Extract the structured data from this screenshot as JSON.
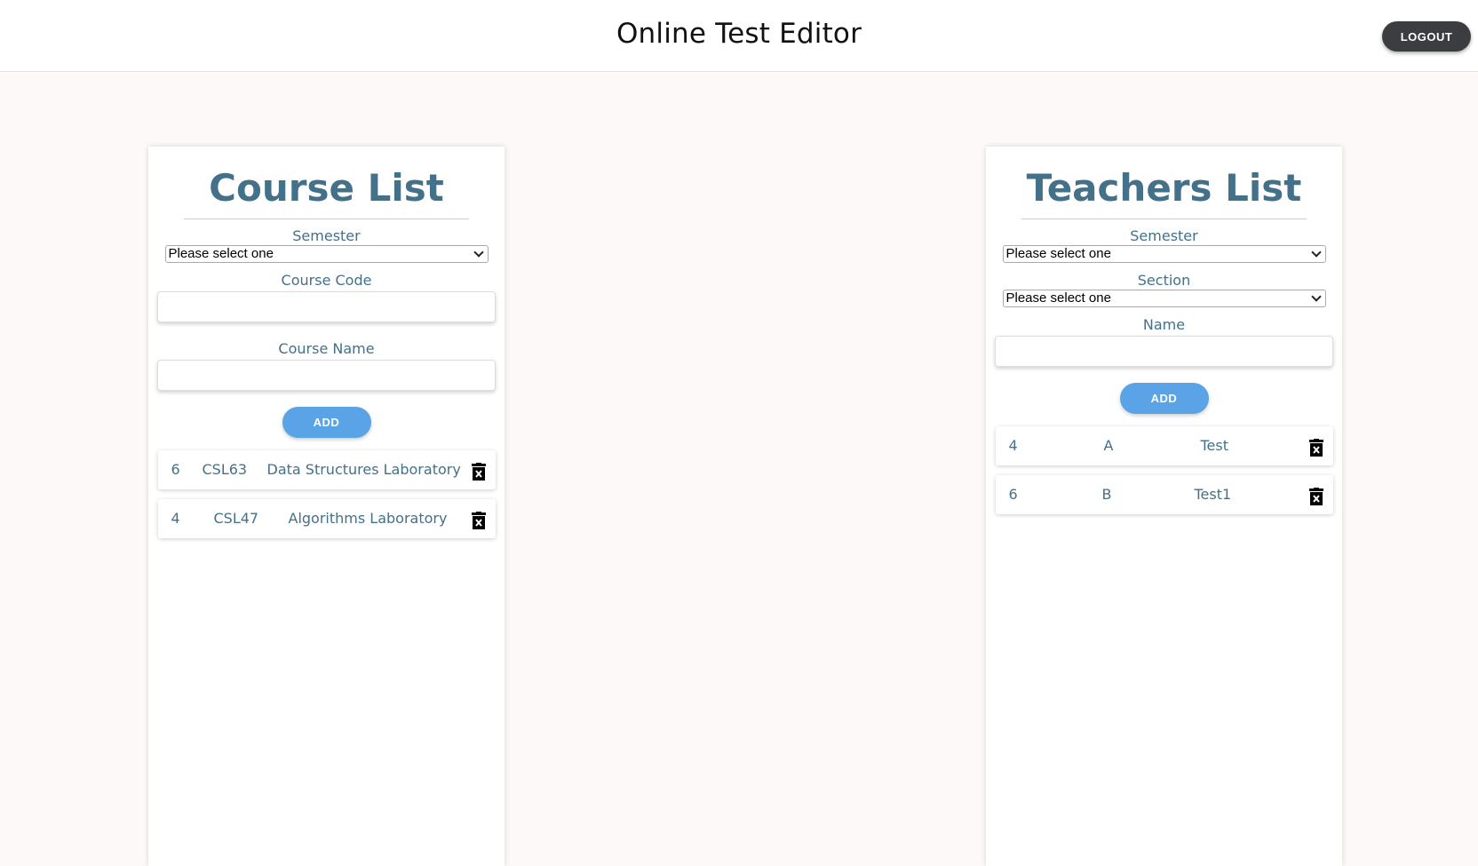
{
  "header": {
    "title": "Online Test Editor",
    "logout_label": "LOGOUT"
  },
  "course_panel": {
    "title": "Course List",
    "semester_label": "Semester",
    "semester_value": "Please select one",
    "course_code_label": "Course Code",
    "course_code_value": "",
    "course_name_label": "Course Name",
    "course_name_value": "",
    "add_label": "ADD",
    "rows": [
      {
        "semester": "6",
        "code": "CSL63",
        "name": "Data Structures Laboratory"
      },
      {
        "semester": "4",
        "code": "CSL47",
        "name": "Algorithms Laboratory"
      }
    ]
  },
  "teacher_panel": {
    "title": "Teachers List",
    "semester_label": "Semester",
    "semester_value": "Please select one",
    "section_label": "Section",
    "section_value": "Please select one",
    "name_label": "Name",
    "name_value": "",
    "add_label": "ADD",
    "rows": [
      {
        "semester": "4",
        "section": "A",
        "name": "Test"
      },
      {
        "semester": "6",
        "section": "B",
        "name": "Test1"
      }
    ]
  },
  "icons": {
    "delete": "trash-x-icon",
    "dropdown": "chevron-down-icon"
  },
  "colors": {
    "accent_text": "#43718a",
    "add_button": "#5aa3e6",
    "logout_button": "#3b3d40",
    "page_bg": "#fdf9f8"
  }
}
